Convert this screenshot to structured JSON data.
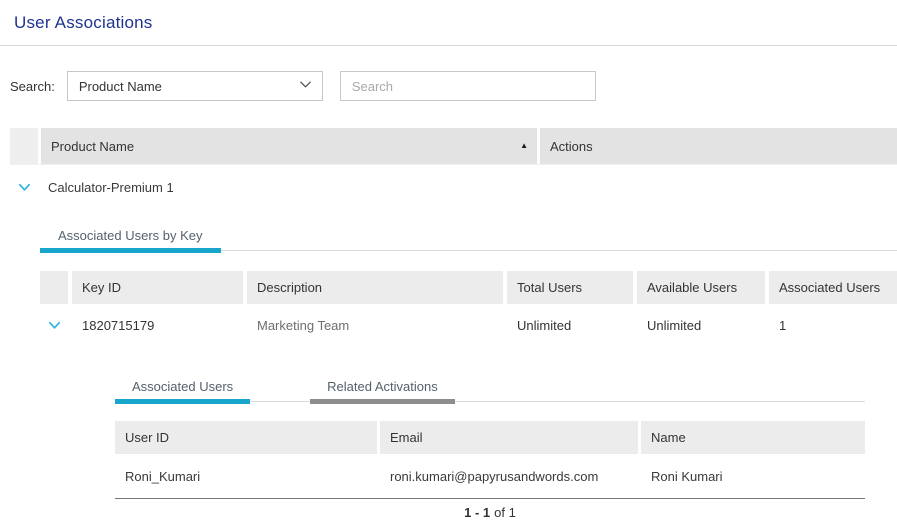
{
  "colors": {
    "title": "#1f3391",
    "accent": "#18a6cd",
    "chevron": "#2fb3dc",
    "inactive_tab": "#8d8d8d"
  },
  "icons": {
    "sort_ascending": "▲"
  },
  "page": {
    "title": "User Associations"
  },
  "search": {
    "label": "Search:",
    "category_selected": "Product Name",
    "placeholder": "Search"
  },
  "products": {
    "columns": [
      "Product Name",
      "Actions"
    ],
    "rows": [
      {
        "name": "Calculator-Premium 1"
      }
    ]
  },
  "keys": {
    "tab_label": "Associated Users by Key",
    "columns": [
      "Key ID",
      "Description",
      "Total Users",
      "Available Users",
      "Associated Users"
    ],
    "rows": [
      {
        "key_id": "1820715179",
        "description": "Marketing Team",
        "total_users": "Unlimited",
        "available_users": "Unlimited",
        "associated_users": "1"
      }
    ]
  },
  "users": {
    "tabs": [
      {
        "label": "Associated Users"
      },
      {
        "label": "Related Activations"
      }
    ],
    "columns": [
      "User ID",
      "Email",
      "Name"
    ],
    "rows": [
      {
        "user_id": "Roni_Kumari",
        "email": "roni.kumari@papyrusandwords.com",
        "name": "Roni Kumari"
      }
    ],
    "pagination": {
      "range": "1 - 1",
      "of": "of 1"
    }
  }
}
